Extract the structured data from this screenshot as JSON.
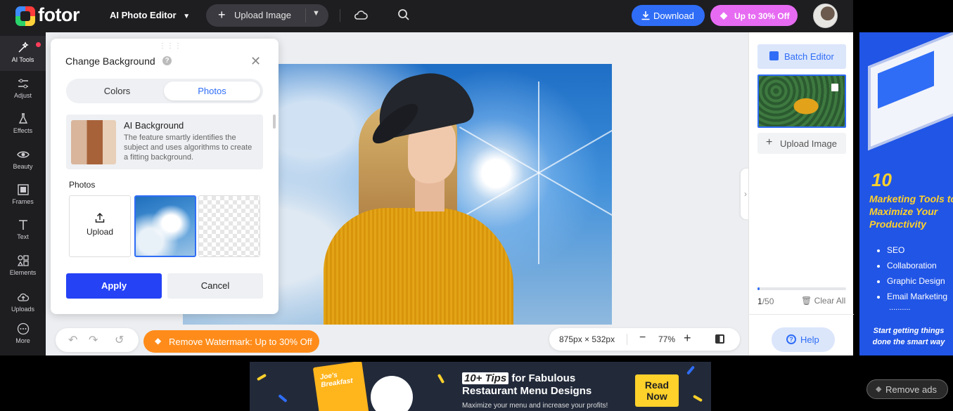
{
  "header": {
    "brand": "fotor",
    "editor_label": "AI Photo Editor",
    "upload_label": "Upload Image",
    "download_label": "Download",
    "promo_label": "Up to 30% Off"
  },
  "sidebar": {
    "items": [
      {
        "label": "AI Tools"
      },
      {
        "label": "Adjust"
      },
      {
        "label": "Effects"
      },
      {
        "label": "Beauty"
      },
      {
        "label": "Frames"
      },
      {
        "label": "Text"
      },
      {
        "label": "Elements"
      },
      {
        "label": "Uploads"
      },
      {
        "label": "More"
      }
    ]
  },
  "bg_panel": {
    "title": "Change Background",
    "help": "?",
    "tabs": [
      {
        "label": "Colors"
      },
      {
        "label": "Photos"
      }
    ],
    "selected_tab": "Photos",
    "ai_card": {
      "title": "AI Background",
      "description": "The feature smartly identifies the subject and uses algorithms to create a fitting background."
    },
    "photos_label": "Photos",
    "upload_tile_label": "Upload",
    "apply_label": "Apply",
    "cancel_label": "Cancel"
  },
  "canvas_bar": {
    "watermark_label": "Remove Watermark: Up to 30% Off",
    "dimensions": "875px × 532px",
    "zoom": "77%"
  },
  "right_panel": {
    "batch_label": "Batch Editor",
    "upload_label": "Upload Image",
    "count_current": "1",
    "count_total": "/50",
    "progress": 0.02,
    "clear_label": "Clear All",
    "help_label": "Help"
  },
  "ad_right": {
    "number": "10",
    "title": "Marketing Tools to Maximize Your Productivity",
    "items": [
      "SEO",
      "Collaboration",
      "Graphic Design",
      "Email Marketing"
    ],
    "ellipsis": "..........",
    "footer": "Start getting things done the smart way"
  },
  "ad_bottom": {
    "menu_card_text": "Joe's Breakfast",
    "tag": "10+ Tips",
    "title_rest": "for Fabulous",
    "title_line2": "Restaurant Menu Designs",
    "subtitle": "Maximize your menu and increase your profits!",
    "cta_line1": "Read",
    "cta_line2": "Now"
  },
  "remove_ads_label": "Remove ads",
  "colors": {
    "accent": "#2f6df6",
    "apply": "#2542f5",
    "promo": "#e66bf2",
    "watermark": "#ff8c1a",
    "topbar": "#1e1e21"
  }
}
